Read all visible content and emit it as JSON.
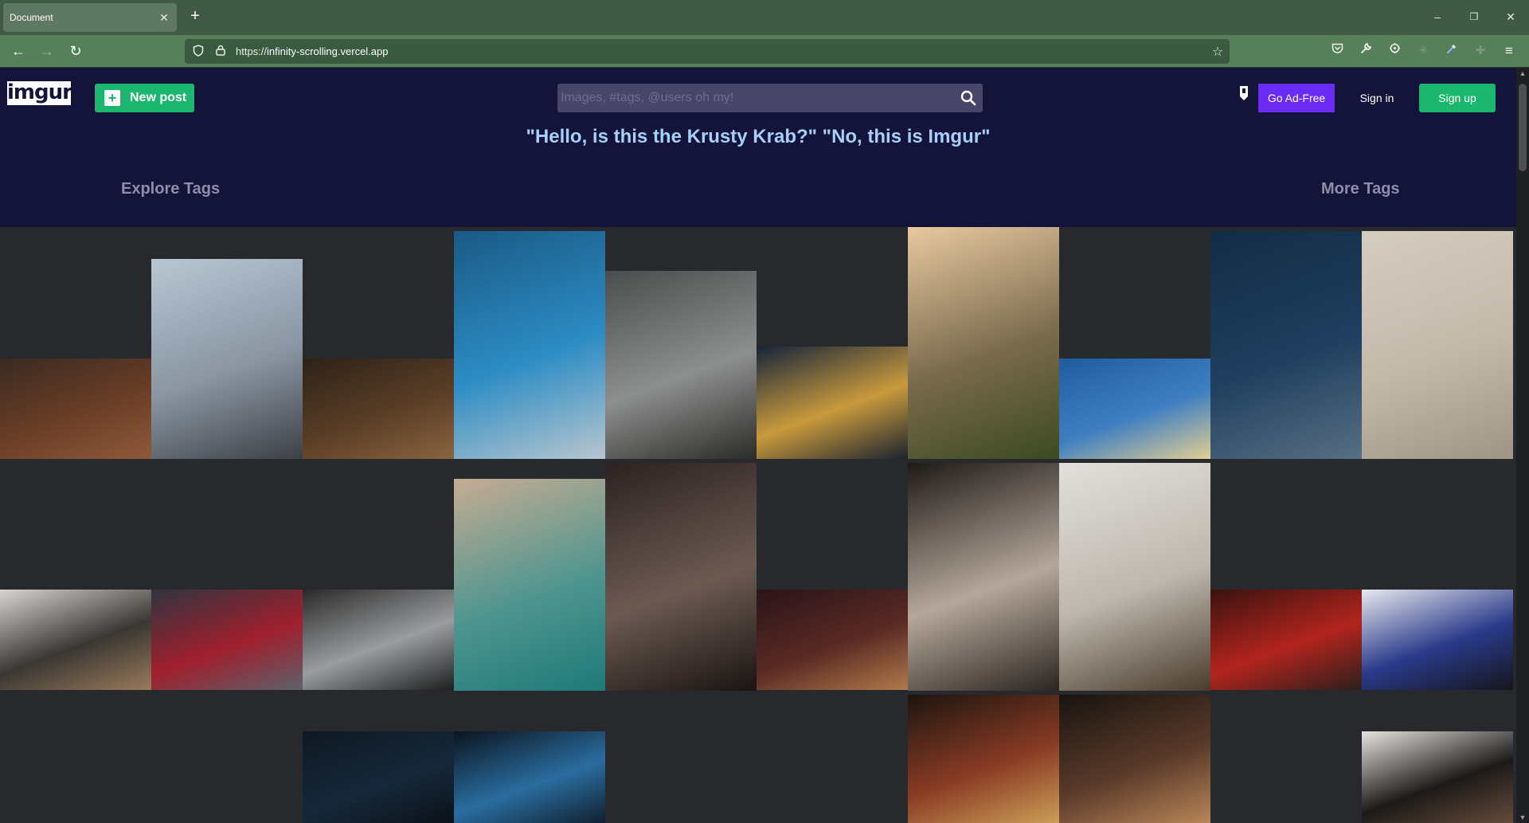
{
  "browser": {
    "tab_title": "Document",
    "tab_close": "✕",
    "new_tab": "+",
    "url_scheme": "https://",
    "url_host": "infinity-scrolling.vercel.app",
    "window_controls": {
      "minimize": "–",
      "restore": "❐",
      "close": "✕"
    },
    "nav": {
      "back": "←",
      "forward": "→",
      "reload": "↻"
    },
    "icons": [
      "pocket-icon",
      "wrench-icon",
      "extension-icon",
      "dim-extension-icon",
      "eyedropper-icon",
      "dim-grid-icon",
      "menu-icon"
    ]
  },
  "site": {
    "logo_text": "imgur",
    "new_post_label": "New post",
    "search_placeholder": "Images, #tags, @users oh my!",
    "go_adfree_label": "Go Ad-Free",
    "signin_label": "Sign in",
    "signup_label": "Sign up",
    "tagline": "\"Hello, is this the Krusty Krab?\" \"No, this is Imgur\"",
    "explore_tags_label": "Explore Tags",
    "more_tags_label": "More Tags"
  },
  "colors": {
    "header_bg": "#141339",
    "accent_green": "#1bb76e",
    "accent_purple": "#6a2bf5",
    "tagline": "#a6d0f8",
    "gallery_bg": "#27292d"
  },
  "gallery": {
    "columns": 10,
    "images": [
      {
        "name": "laptop-on-leather-couch",
        "colors": [
          "#3a2a22",
          "#6b3e26",
          "#8f5a3b"
        ]
      },
      {
        "name": "new-york-skyline",
        "colors": [
          "#b9c6d3",
          "#8a95a3",
          "#3d4045"
        ]
      },
      {
        "name": "desert-sand-dune-dark",
        "colors": [
          "#2d2218",
          "#5a3e26",
          "#8a6440"
        ]
      },
      {
        "name": "skyscraper-blue-sky",
        "colors": [
          "#1a5a85",
          "#2c8cc4",
          "#b8c6cf"
        ]
      },
      {
        "name": "escalator",
        "colors": [
          "#4a4c4d",
          "#8d8f8f",
          "#2b2c26"
        ]
      },
      {
        "name": "tezos-phone-coins",
        "colors": [
          "#16243a",
          "#c99a3c",
          "#1b2330"
        ]
      },
      {
        "name": "woman-by-river-sunset",
        "colors": [
          "#e8c9a0",
          "#7a6a4d",
          "#3c4a22"
        ]
      },
      {
        "name": "blue-sky-sand-dune",
        "colors": [
          "#1e5c9e",
          "#3f7fc1",
          "#e3cf93"
        ]
      },
      {
        "name": "snowy-cabin-night",
        "colors": [
          "#122c45",
          "#1f3f5f",
          "#586f84"
        ]
      },
      {
        "name": "typed-letter-paper",
        "colors": [
          "#d4cdc0",
          "#c2b9aa",
          "#9e9585"
        ]
      },
      {
        "name": "laptop-with-plant",
        "colors": [
          "#d9d6d2",
          "#3a3733",
          "#9a7a5b"
        ]
      },
      {
        "name": "red-window-frosted-glass",
        "colors": [
          "#2f3540",
          "#a01f2d",
          "#5c616b"
        ]
      },
      {
        "name": "kitchen-window-person",
        "colors": [
          "#2a2a2a",
          "#9a9c9e",
          "#1d1e1f"
        ]
      },
      {
        "name": "aerial-beach-waves",
        "colors": [
          "#c6ac92",
          "#4f958f",
          "#1e7a78"
        ]
      },
      {
        "name": "wedding-couple-veil",
        "colors": [
          "#2c2220",
          "#6c5a52",
          "#1a1412"
        ]
      },
      {
        "name": "stack-of-coins",
        "colors": [
          "#2a1419",
          "#5a2a24",
          "#b07a4a"
        ]
      },
      {
        "name": "arched-window-city-view",
        "colors": [
          "#1e1a17",
          "#b5a79a",
          "#2b2420"
        ]
      },
      {
        "name": "dining-table-room",
        "colors": [
          "#e2e0dc",
          "#bdb7ad",
          "#4a3c2d"
        ]
      },
      {
        "name": "man-in-red-plaid",
        "colors": [
          "#3a1210",
          "#b2241d",
          "#2c1f1d"
        ]
      },
      {
        "name": "blue-paint-drips",
        "colors": [
          "#e8e9ef",
          "#2a3a8a",
          "#15161c"
        ]
      },
      {
        "name": "dark-blue-building",
        "colors": [
          "#0e1822",
          "#16283a",
          "#0a1017"
        ]
      },
      {
        "name": "tower-blue-glow",
        "colors": [
          "#0b141e",
          "#2a6da0",
          "#0f1b27"
        ]
      },
      {
        "name": "city-street-night",
        "colors": [
          "#1c1510",
          "#8a3b24",
          "#cfa35a"
        ]
      },
      {
        "name": "elevated-train-street",
        "colors": [
          "#181410",
          "#5a3a2a",
          "#bd8a5a"
        ]
      },
      {
        "name": "woman-black-dress",
        "colors": [
          "#e8e5e0",
          "#1c1a18",
          "#6b4e3e"
        ]
      }
    ]
  }
}
